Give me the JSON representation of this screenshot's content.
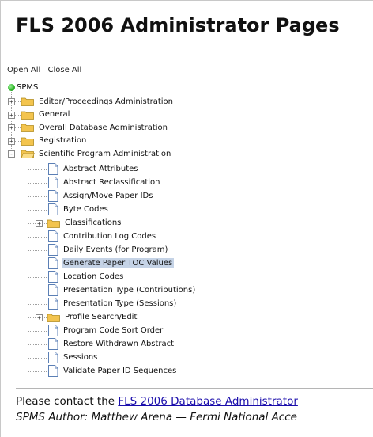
{
  "title": "FLS 2006 Administrator Pages",
  "toolbar": {
    "open_all": "Open All",
    "close_all": "Close All"
  },
  "tree": {
    "root": "SPMS",
    "groups": [
      "Editor/Proceedings Administration",
      "General",
      "Overall Database Administration",
      "Registration",
      "Scientific Program Administration"
    ],
    "children": [
      "Abstract Attributes",
      "Abstract Reclassification",
      "Assign/Move Paper IDs",
      "Byte Codes",
      "Classifications",
      "Contribution Log Codes",
      "Daily Events (for Program)",
      "Generate Paper TOC Values",
      "Location Codes",
      "Presentation Type (Contributions)",
      "Presentation Type (Sessions)",
      "Profile Search/Edit",
      "Program Code Sort Order",
      "Restore Withdrawn Abstract",
      "Sessions",
      "Validate Paper ID Sequences"
    ],
    "selected": "Generate Paper TOC Values"
  },
  "footer": {
    "contact_prefix": "Please contact the ",
    "contact_link": "FLS 2006 Database Administrator",
    "author_line": "SPMS Author:  Matthew Arena — Fermi National Acce"
  },
  "colors": {
    "selected_bg": "#c5d3e6",
    "link": "#1a0dab",
    "folder": "#f3c44e"
  }
}
